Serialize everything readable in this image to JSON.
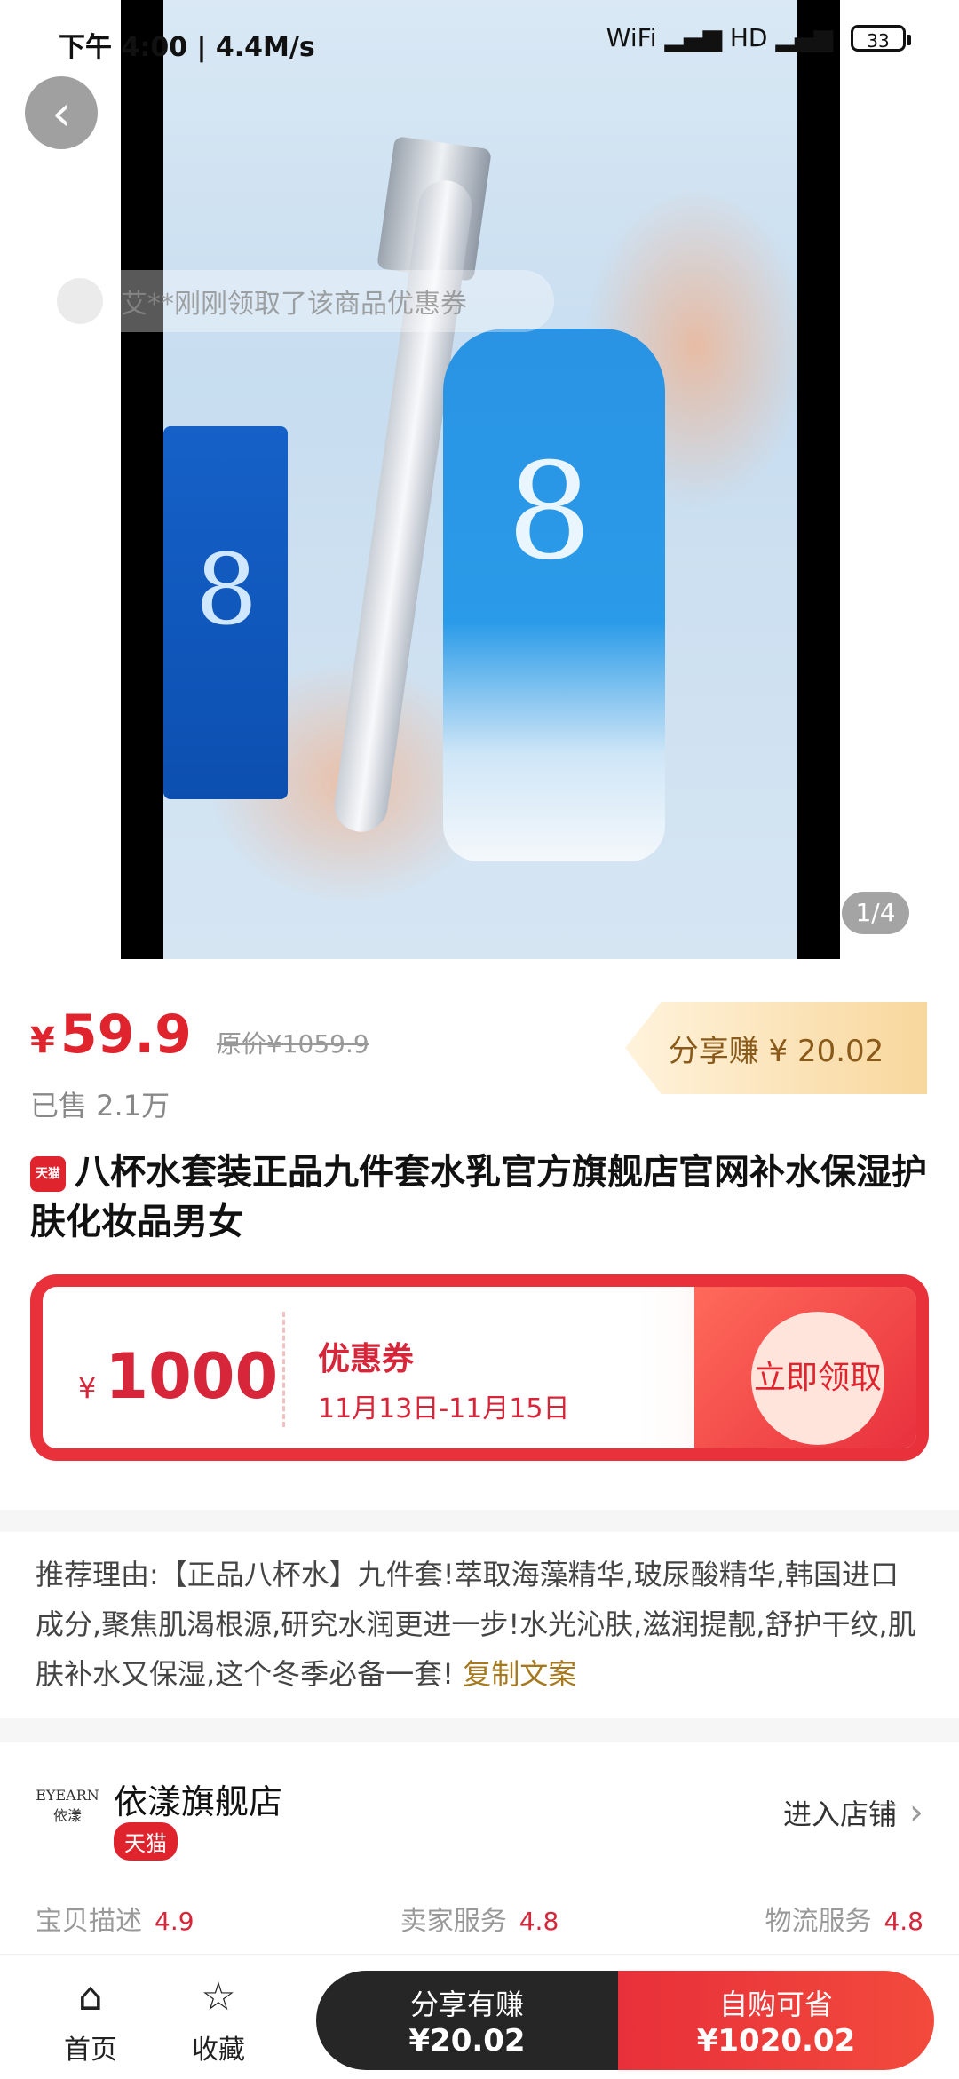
{
  "status_bar": {
    "time": "下午 4:00 | 4.4M/s",
    "signal": "WiFi ▂▄▆ HD ▂▄▆",
    "battery": "33"
  },
  "media": {
    "toast": "艾**刚刚领取了该商品优惠券",
    "counter": "1/4",
    "bottle_mark": "8",
    "box_mark": "8"
  },
  "price": {
    "currency": "¥",
    "current": "59.9",
    "original": "原价¥1059.9",
    "sold": "已售 2.1万",
    "share_tag": "分享赚 ¥ 20.02"
  },
  "title": {
    "badge": "天猫",
    "text": "八杯水套装正品九件套水乳官方旗舰店官网补水保湿护肤化妆品男女"
  },
  "coupon": {
    "currency": "¥",
    "amount": "1000",
    "label": "优惠券",
    "date_range": "11月13日-11月15日",
    "claim_button": "立即领取"
  },
  "recommend": {
    "text": "推荐理由:【正品八杯水】九件套!萃取海藻精华,玻尿酸精华,韩国进口成分,聚焦肌渴根源,研究水润更进一步!水光沁肤,滋润提靓,舒护干纹,肌肤补水又保湿,这个冬季必备一套!",
    "copy_link": "复制文案"
  },
  "shop": {
    "logo_text": "EYEARN 依漾",
    "name": "依漾旗舰店",
    "badge": "天猫",
    "enter": "进入店铺",
    "scores": [
      {
        "label": "宝贝描述",
        "value": "4.9"
      },
      {
        "label": "卖家服务",
        "value": "4.8"
      },
      {
        "label": "物流服务",
        "value": "4.8"
      }
    ]
  },
  "bottom_bar": {
    "home": "首页",
    "favorite": "收藏",
    "share_label": "分享有赚",
    "share_amount": "¥20.02",
    "buy_label": "自购可省",
    "buy_amount": "¥1020.02"
  },
  "colors": {
    "accent_red": "#e0242e",
    "gold": "#a6791f",
    "dark_button": "#262626"
  }
}
